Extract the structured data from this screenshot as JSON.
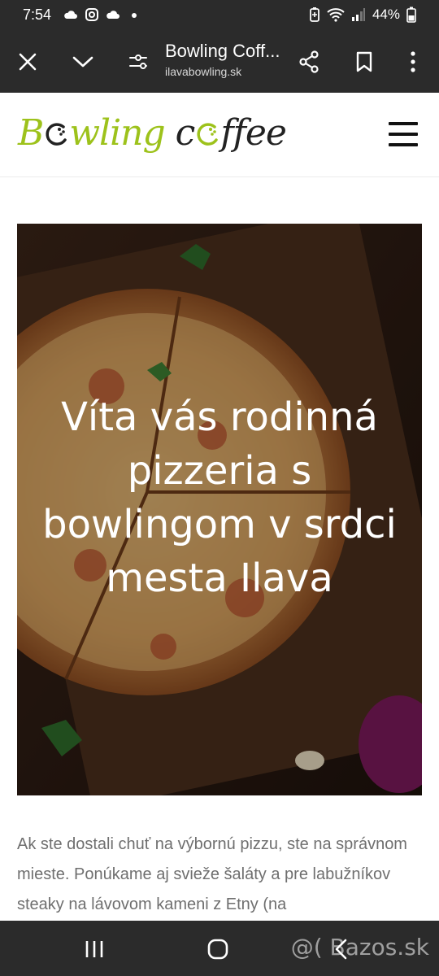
{
  "status_bar": {
    "time": "7:54",
    "battery": "44%",
    "left_icons": [
      "cloud-icon",
      "instagram-icon",
      "cloud-icon",
      "dot-icon"
    ],
    "right_icons": [
      "battery-saver-icon",
      "wifi-icon",
      "signal-icon",
      "battery-icon"
    ]
  },
  "browser": {
    "title": "Bowling Coff...",
    "url": "ilavabowling.sk",
    "icons": [
      "close-icon",
      "chevron-down-icon",
      "page-settings-icon",
      "share-icon",
      "bookmark-icon",
      "more-vert-icon"
    ]
  },
  "site": {
    "logo": {
      "part1": "B",
      "part2": "wling",
      "part3": "c",
      "part4": "ffee"
    },
    "colors": {
      "logo_green": "#9dc21b",
      "logo_dark": "#222222",
      "text_gray": "#6f6f6f"
    }
  },
  "hero": {
    "heading": "Víta vás rodinná pizzeria s bowlingom v srdci mesta Ilava"
  },
  "intro": {
    "text": "Ak ste dostali chuť na výbornú pizzu, ste na správnom mieste. Ponúkame aj svieže šaláty a pre labužníkov steaky na lávovom kameni z Etny (na"
  },
  "nav": {
    "icons": [
      "recent-apps-icon",
      "home-icon",
      "back-icon"
    ]
  },
  "watermark": "@( Bazos.sk"
}
